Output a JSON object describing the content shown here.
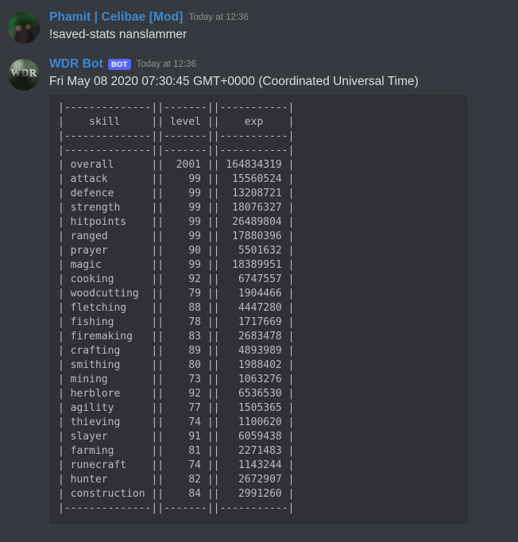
{
  "app": "discord",
  "colors": {
    "page_background": "#36393f",
    "codeblock_background": "#2f3136",
    "username": "#3f88d4",
    "bot_badge": "#5865f2",
    "timestamp": "#8e9297",
    "body_text": "#dcddde",
    "code_text": "#b9bbbe"
  },
  "messages": [
    {
      "id": "msg-command",
      "author": "Phamit | Celibae [Mod]",
      "is_bot": false,
      "bot_label": "",
      "timestamp": "Today at 12:36",
      "avatar_name": "avatar-phamit",
      "text": "!saved-stats nanslammer"
    },
    {
      "id": "msg-bot-response",
      "author": "WDR Bot",
      "is_bot": true,
      "bot_label": "BOT",
      "timestamp": "Today at 12:36",
      "avatar_name": "avatar-wdr-bot",
      "avatar_text": "WDR",
      "text": "Fri May 08 2020 07:30:45 GMT+0000 (Coordinated Universal Time)"
    }
  ],
  "stats_table": {
    "columns": [
      "skill",
      "level",
      "exp"
    ],
    "rows": [
      {
        "skill": "overall",
        "level": "2001",
        "exp": "164834319"
      },
      {
        "skill": "attack",
        "level": "99",
        "exp": "15560524"
      },
      {
        "skill": "defence",
        "level": "99",
        "exp": "13208721"
      },
      {
        "skill": "strength",
        "level": "99",
        "exp": "18076327"
      },
      {
        "skill": "hitpoints",
        "level": "99",
        "exp": "26489804"
      },
      {
        "skill": "ranged",
        "level": "99",
        "exp": "17880396"
      },
      {
        "skill": "prayer",
        "level": "90",
        "exp": "5501632"
      },
      {
        "skill": "magic",
        "level": "99",
        "exp": "18389951"
      },
      {
        "skill": "cooking",
        "level": "92",
        "exp": "6747557"
      },
      {
        "skill": "woodcutting",
        "level": "79",
        "exp": "1904466"
      },
      {
        "skill": "fletching",
        "level": "88",
        "exp": "4447280"
      },
      {
        "skill": "fishing",
        "level": "78",
        "exp": "1717669"
      },
      {
        "skill": "firemaking",
        "level": "83",
        "exp": "2683478"
      },
      {
        "skill": "crafting",
        "level": "89",
        "exp": "4893989"
      },
      {
        "skill": "smithing",
        "level": "80",
        "exp": "1988402"
      },
      {
        "skill": "mining",
        "level": "73",
        "exp": "1063276"
      },
      {
        "skill": "herblore",
        "level": "92",
        "exp": "6536530"
      },
      {
        "skill": "agility",
        "level": "77",
        "exp": "1505365"
      },
      {
        "skill": "thieving",
        "level": "74",
        "exp": "1100620"
      },
      {
        "skill": "slayer",
        "level": "91",
        "exp": "6059438"
      },
      {
        "skill": "farming",
        "level": "81",
        "exp": "2271483"
      },
      {
        "skill": "runecraft",
        "level": "74",
        "exp": "1143244"
      },
      {
        "skill": "hunter",
        "level": "82",
        "exp": "2672907"
      },
      {
        "skill": "construction",
        "level": "84",
        "exp": "2991260"
      }
    ]
  }
}
